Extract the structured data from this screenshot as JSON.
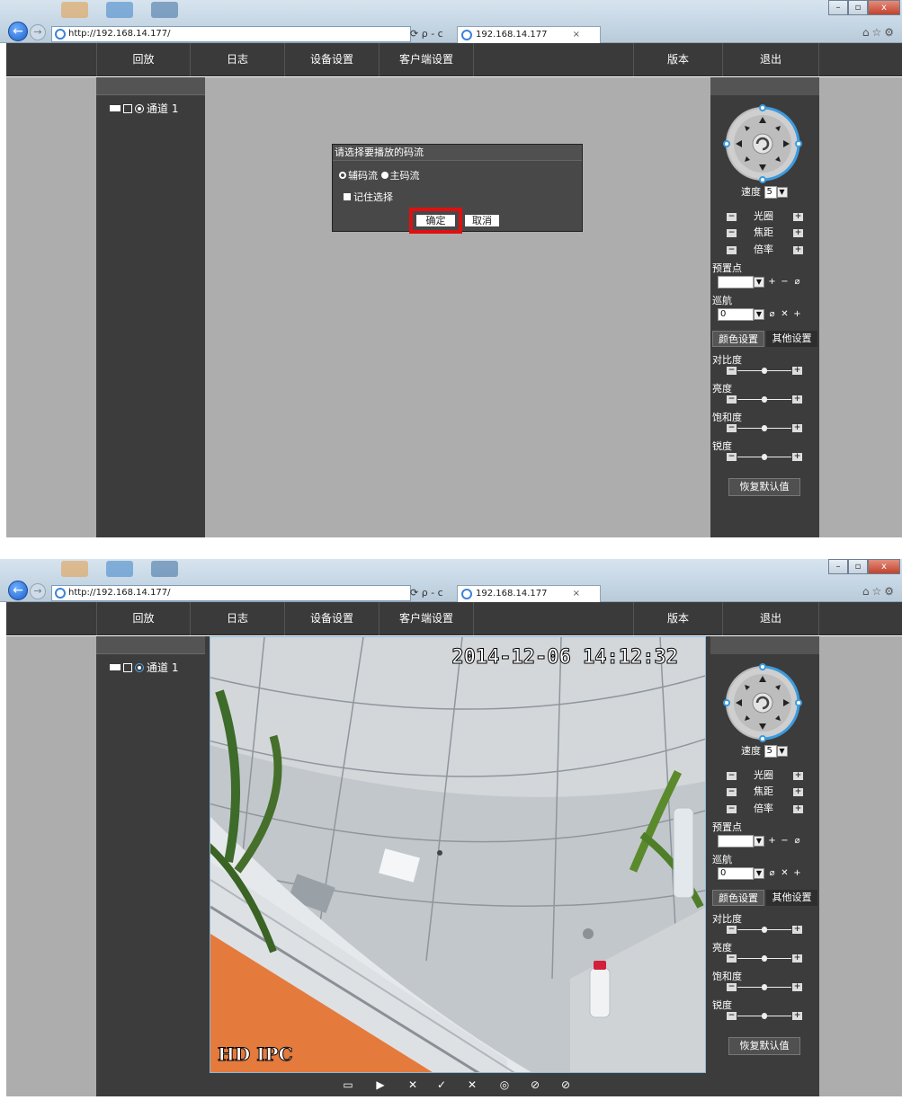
{
  "browser": {
    "address": "http://192.168.14.177/",
    "tab_title": "192.168.14.177",
    "tab_close": "×",
    "back": "←",
    "forward": "→",
    "addr_tools": "⟳ ρ - c",
    "win_min": "–",
    "win_max": "▫",
    "win_close": "x",
    "ie_tools": "⌂☆⚙"
  },
  "nav": {
    "playback": "回放",
    "log": "日志",
    "device_settings": "设备设置",
    "client_settings": "客户端设置",
    "version": "版本",
    "logout": "退出"
  },
  "channel": {
    "label": "通道 1"
  },
  "dialog": {
    "title": "请选择要播放的码流",
    "sub_stream": "辅码流",
    "main_stream": "主码流",
    "selected_stream": "sub_stream",
    "remember": "记住选择",
    "ok": "确定",
    "cancel": "取消",
    "ok_highlight_color": "#e01010"
  },
  "ptz": {
    "speed_label": "速度",
    "speed_value": "5",
    "iris": "光圈",
    "focus": "焦距",
    "zoom": "倍率",
    "minus": "−",
    "plus": "+",
    "preset_label": "预置点",
    "preset_value": "",
    "cruise_label": "巡航",
    "cruise_value": "0",
    "arrow": "▼",
    "preset_add": "+",
    "preset_del": "−",
    "preset_goto": "⌀",
    "cruise_goto": "⌀",
    "cruise_del": "✕",
    "cruise_add": "+"
  },
  "color": {
    "tab_color": "颜色设置",
    "tab_other": "其他设置",
    "contrast": "对比度",
    "brightness": "亮度",
    "saturation": "饱和度",
    "sharpness": "锐度",
    "levels": {
      "contrast": 0.5,
      "brightness": 0.5,
      "saturation": 0.5,
      "sharpness": 0.5
    },
    "reset": "恢复默认值"
  },
  "video": {
    "timestamp": "2014-12-06 14:12:32",
    "overlay": "HD IPC"
  },
  "video_toolbar": {
    "icons": [
      "monitor-icon",
      "play-icon",
      "stop-icon",
      "record-icon",
      "stop-record-icon",
      "snapshot-icon",
      "audio-off-icon",
      "talk-off-icon"
    ],
    "glyphs": [
      "▭",
      "▶",
      "✕",
      "✓",
      "✕",
      "◎",
      "⊘",
      "⊘"
    ]
  },
  "colors": {
    "nav_bg": "#3a3a3a",
    "panel_bg": "#3c3c3c",
    "content_gray": "#adadad",
    "ptz_ring": "#3a9be0"
  }
}
